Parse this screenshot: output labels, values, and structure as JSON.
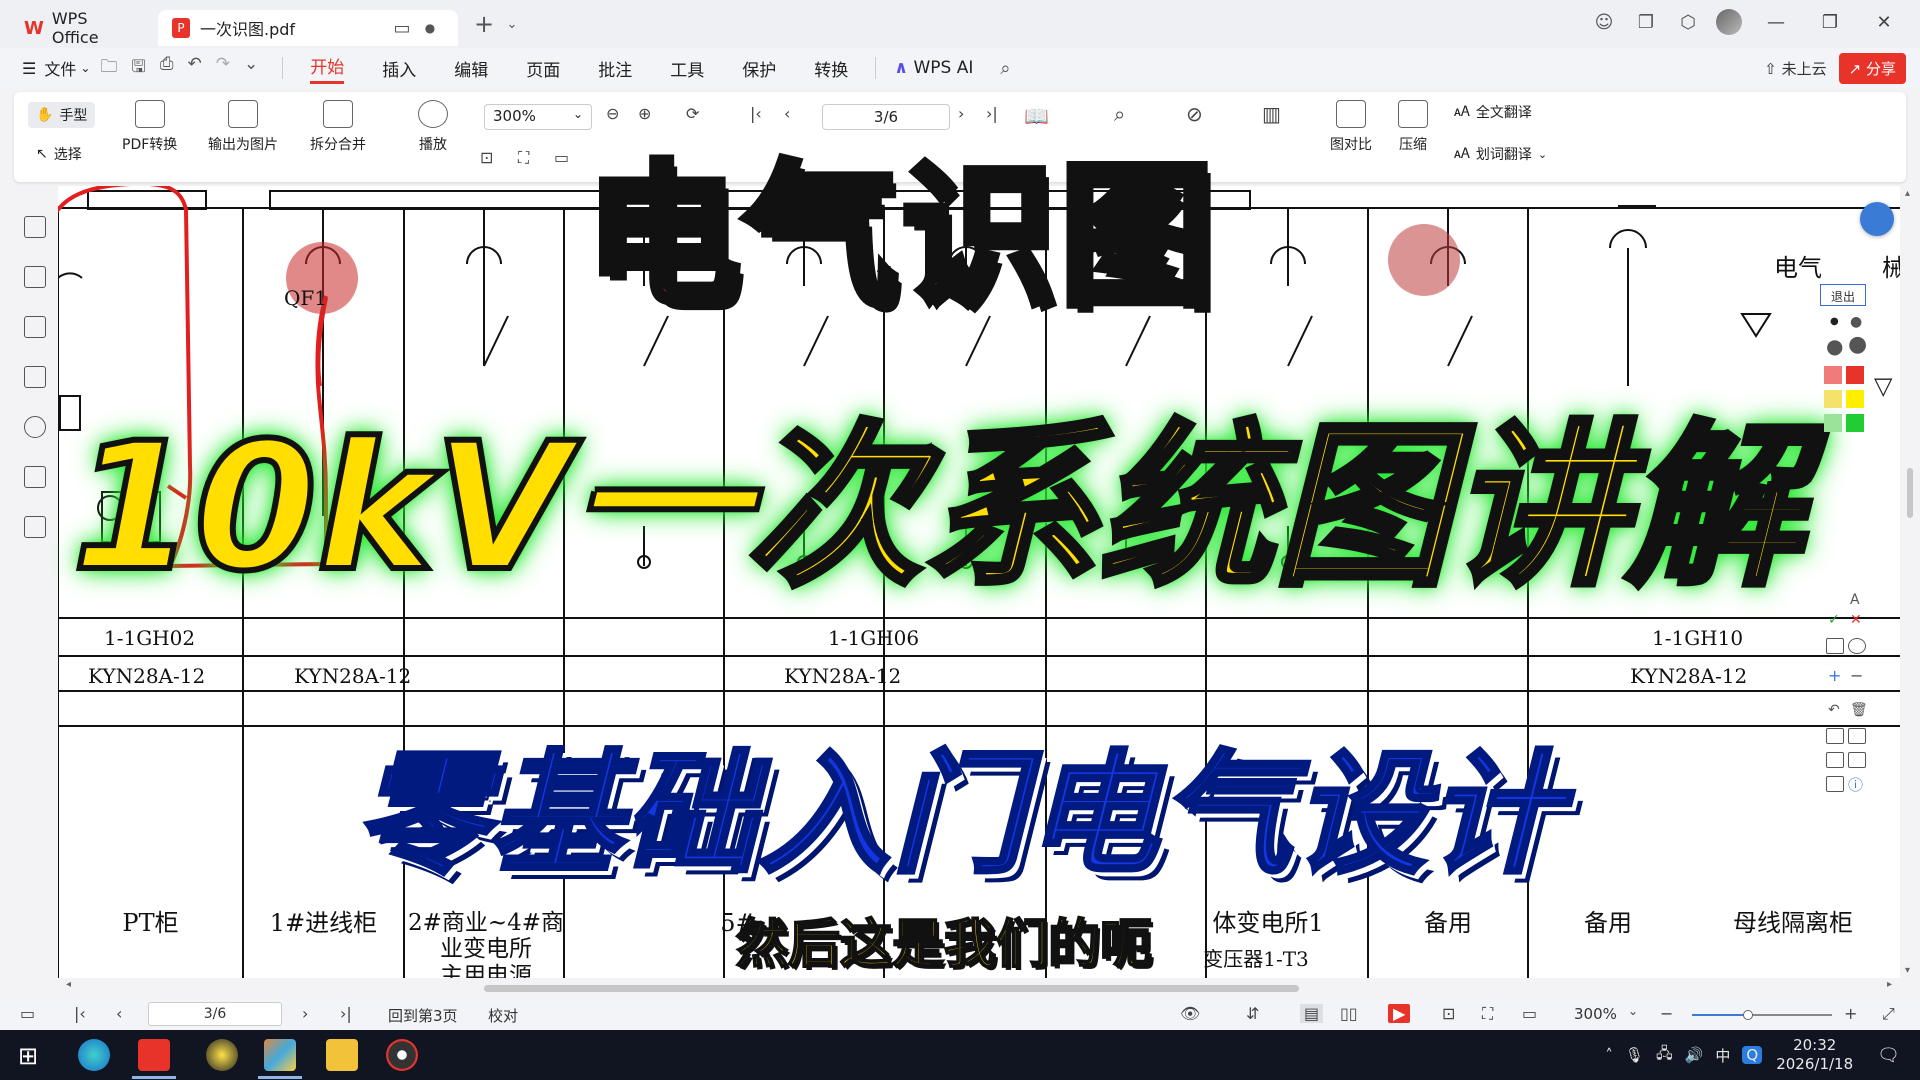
{
  "titlebar": {
    "app_tab": "WPS Office",
    "doc_tab": "一次识图.pdf",
    "new_tab": "+"
  },
  "menu": {
    "file": "文件",
    "items": [
      "开始",
      "插入",
      "编辑",
      "页面",
      "批注",
      "工具",
      "保护",
      "转换"
    ],
    "active": "开始",
    "ai": "WPS AI",
    "cloud": "未上云",
    "share": "分享"
  },
  "ribbon": {
    "hand": "手型",
    "select": "选择",
    "pdf_convert": "PDF转换",
    "export_image": "输出为图片",
    "split_merge": "拆分合并",
    "play": "播放",
    "zoom": "300%",
    "page": "3/6",
    "compare": "图对比",
    "compress": "压缩",
    "full_translate": "全文翻译",
    "word_translate": "划词翻译"
  },
  "document": {
    "qf_label": "QF1",
    "cell_ids": [
      "1-1GH02",
      "1-1GH06",
      "1-1GH10"
    ],
    "cell_models": [
      "KYN28A-12",
      "KYN28A-12",
      "KYN28A-12",
      "KYN28A-12"
    ],
    "cells": [
      {
        "name": "PT柜"
      },
      {
        "name": "1#进线柜"
      },
      {
        "name": "2#商业~4#商业变电所",
        "sub": "主用电源"
      },
      {
        "name": "备用"
      },
      {
        "name": "备用"
      },
      {
        "name": "母线隔离柜"
      }
    ],
    "partial_right": "电气",
    "partial_right2": "械",
    "partial_5": "5#",
    "partial_t3": "变压器1-T3",
    "partial_sub": "体变电所1"
  },
  "overlay": {
    "title_main": "电气识图",
    "title_big": "10kV一次系统图讲解",
    "title_sub": "零基础入门电气设计",
    "caption": "然后这是我们的呃"
  },
  "palette": {
    "exit": "退出",
    "colors": [
      "#f07b7b",
      "#e8332a",
      "#f4e26b",
      "#ffee00",
      "#9be29b",
      "#22cc33"
    ]
  },
  "statusbar": {
    "page": "3/6",
    "back": "回到第3页",
    "proof": "校对",
    "zoom": "300%",
    "zoom_level": 0.4
  },
  "taskbar": {
    "time": "20:32",
    "date": "2026/1/18",
    "ime": "中"
  },
  "colors": {
    "accent": "#e8332a",
    "title_red": "#f0474f",
    "title_yellow": "#ffde00",
    "title_blue": "#1436e0",
    "glow_green": "#22e82c"
  }
}
